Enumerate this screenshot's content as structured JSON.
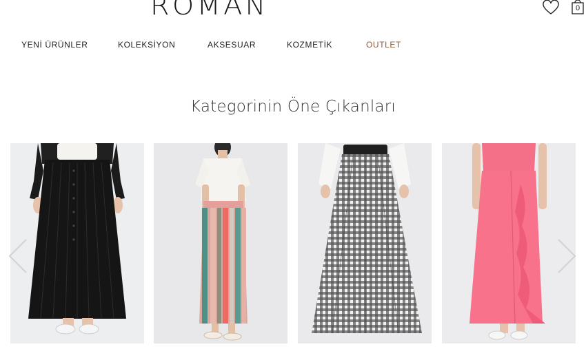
{
  "brand": {
    "logo_text": "ROMAN"
  },
  "header": {
    "wishlist_icon": "heart-icon",
    "cart_icon": "shopping-bag-icon",
    "cart_count": "0"
  },
  "nav": {
    "items": [
      {
        "label": "YENİ ÜRÜNLER"
      },
      {
        "label": "KOLEKSİYON"
      },
      {
        "label": "AKSESUAR"
      },
      {
        "label": "KOZMETİK"
      },
      {
        "label": "OUTLET",
        "color": "#8a5a3c"
      }
    ]
  },
  "section": {
    "title": "Kategorinin Öne Çıkanları"
  },
  "carousel": {
    "prev_icon": "chevron-left-icon",
    "next_icon": "chevron-right-icon",
    "products": [
      {
        "image": "black-pleated-maxi-skirt",
        "color": "#111111"
      },
      {
        "image": "striped-pleated-midi-skirt",
        "color": "#e7a69a"
      },
      {
        "image": "gingham-maxi-skirt",
        "color": "#3a3a3a"
      },
      {
        "image": "pink-ruffle-maxi-skirt",
        "color": "#f36f86"
      }
    ]
  }
}
